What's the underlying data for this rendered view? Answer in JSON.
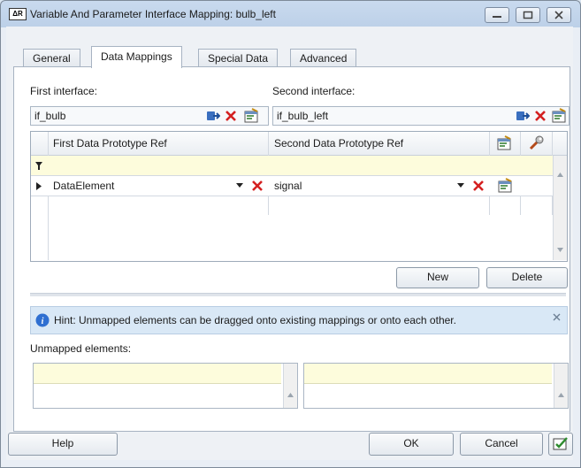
{
  "window": {
    "app_logo_text": "ΔR",
    "title": "Variable And Parameter Interface Mapping: bulb_left"
  },
  "tabs": [
    {
      "label": "General",
      "active": false
    },
    {
      "label": "Data Mappings",
      "active": true
    },
    {
      "label": "Special Data",
      "active": false
    },
    {
      "label": "Advanced",
      "active": false
    }
  ],
  "first_interface": {
    "label": "First interface:",
    "value": "if_bulb"
  },
  "second_interface": {
    "label": "Second interface:",
    "value": "if_bulb_left"
  },
  "grid": {
    "columns": [
      "First Data Prototype Ref",
      "Second Data Prototype Ref"
    ],
    "rows": [
      {
        "first": "DataElement",
        "second": "signal"
      }
    ]
  },
  "grid_buttons": {
    "new_label": "New",
    "delete_label": "Delete"
  },
  "hint": {
    "text": "Hint: Unmapped elements can be dragged onto existing mappings or onto each other."
  },
  "unmapped": {
    "label": "Unmapped elements:"
  },
  "footer": {
    "help_label": "Help",
    "ok_label": "OK",
    "cancel_label": "Cancel"
  },
  "colors": {
    "accent_red": "#d42020",
    "filter_yellow": "#fdfcdc",
    "hint_blue": "#d9e8f6"
  }
}
